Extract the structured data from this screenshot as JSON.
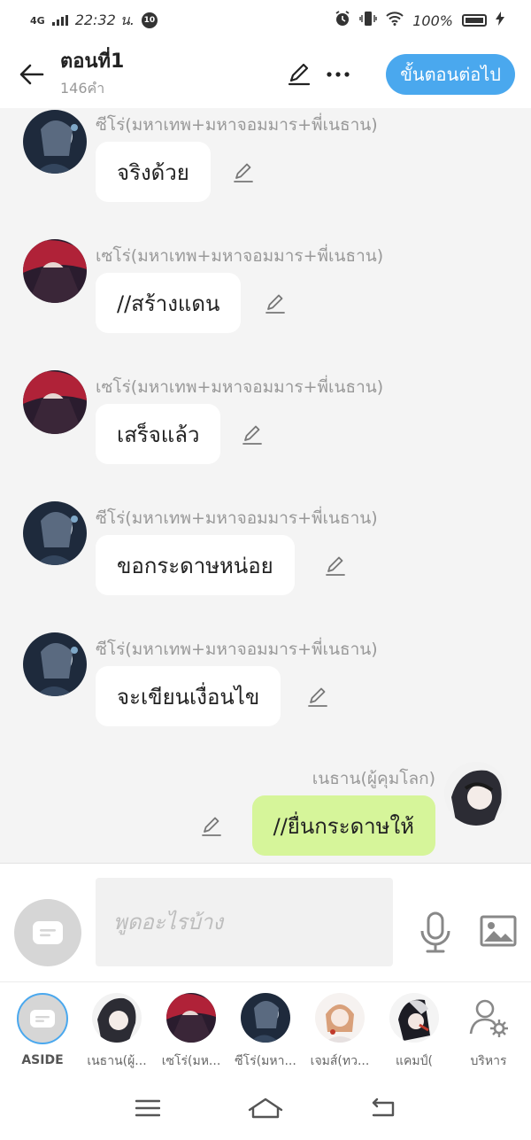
{
  "status_bar": {
    "network": "4G",
    "time": "22:32 น.",
    "notification_badge": "10",
    "battery": "100%"
  },
  "header": {
    "title": "ตอนที่1",
    "word_count": "146คำ",
    "next_button": "ขั้นตอนต่อไป"
  },
  "messages": [
    {
      "sender": "ซีโร่(มหาเทพ+มหาจอมมาร+พี่เนธาน)",
      "text": "จริงด้วย",
      "avatar": "avatar-zero",
      "own": false
    },
    {
      "sender": "เซโร่(มหาเทพ+มหาจอมมาร+พี่เนธาน)",
      "text": "//สร้างแดน",
      "avatar": "avatar-sero",
      "own": false
    },
    {
      "sender": "เซโร่(มหาเทพ+มหาจอมมาร+พี่เนธาน)",
      "text": "เสร็จแล้ว",
      "avatar": "avatar-sero",
      "own": false
    },
    {
      "sender": "ซีโร่(มหาเทพ+มหาจอมมาร+พี่เนธาน)",
      "text": "ขอกระดาษหน่อย",
      "avatar": "avatar-zero",
      "own": false
    },
    {
      "sender": "ซีโร่(มหาเทพ+มหาจอมมาร+พี่เนธาน)",
      "text": "จะเขียนเงื่อนไข",
      "avatar": "avatar-zero",
      "own": false
    },
    {
      "sender": "เนธาน(ผู้คุมโลก)",
      "text": "//ยื่นกระดาษให้",
      "avatar": "avatar-nethan",
      "own": true
    }
  ],
  "composer": {
    "placeholder": "พูดอะไรบ้าง"
  },
  "characters": [
    {
      "name": "ASIDE",
      "kind": "aside"
    },
    {
      "name": "เนธาน(ผู้...",
      "kind": "nethan"
    },
    {
      "name": "เซโร่(มห...",
      "kind": "sero"
    },
    {
      "name": "ซีโร่(มหา...",
      "kind": "zero"
    },
    {
      "name": "เจมส์(ทว...",
      "kind": "james"
    },
    {
      "name": "แคมป์(",
      "kind": "camp"
    },
    {
      "name": "บริหาร",
      "kind": "manage"
    }
  ],
  "colors": {
    "accent": "#4aa8ee",
    "own_bubble": "#d6f59a",
    "other_bubble": "#ffffff",
    "background": "#f4f4f4"
  }
}
